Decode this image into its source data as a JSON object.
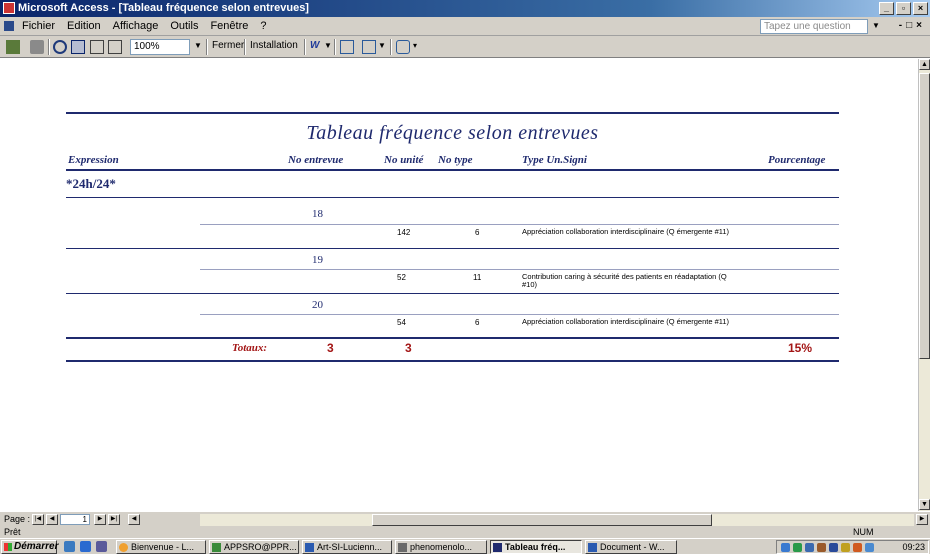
{
  "window": {
    "title": "Microsoft Access - [Tableau fréquence selon entrevues]"
  },
  "menu": {
    "items": [
      "Fichier",
      "Edition",
      "Affichage",
      "Outils",
      "Fenêtre",
      "?"
    ],
    "ask_placeholder": "Tapez une question"
  },
  "toolbar": {
    "zoom": "100%",
    "close_label": "Fermer",
    "setup_label": "Installation"
  },
  "report": {
    "title": "Tableau fréquence selon entrevues",
    "headers": {
      "expression": "Expression",
      "no_entrevue": "No entrevue",
      "no_unite": "No unité",
      "no_type": "No type",
      "type_un_signi": "Type Un.Signi",
      "pourcentage": "Pourcentage"
    },
    "group": "*24h/24*",
    "rows": [
      {
        "entrevue": "18",
        "unite": "142",
        "type": "6",
        "description": "Appréciation collaboration interdisciplinaire (Q émergente #11)"
      },
      {
        "entrevue": "19",
        "unite": "52",
        "type": "11",
        "description": "Contribution caring à sécurité des patients en réadaptation (Q #10)"
      },
      {
        "entrevue": "20",
        "unite": "54",
        "type": "6",
        "description": "Appréciation collaboration interdisciplinaire (Q émergente #11)"
      }
    ],
    "totals": {
      "label": "Totaux:",
      "entrevue_count": "3",
      "unite_count": "3",
      "percentage": "15%"
    }
  },
  "navigation": {
    "page_label": "Page :",
    "page_number": "1"
  },
  "status": {
    "text": "Prêt",
    "num": "NUM"
  },
  "taskbar": {
    "start": "Démarrer",
    "tasks": [
      "Bienvenue - L...",
      "APPSRO@PPR...",
      "Art-SI-Lucienn...",
      "phenomenolo...",
      "Tableau fréq...",
      "Document - W..."
    ],
    "clock": "09:23"
  }
}
